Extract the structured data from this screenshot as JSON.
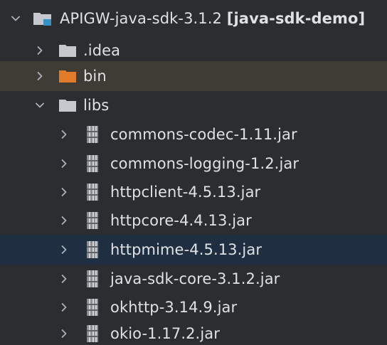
{
  "tree": {
    "root": {
      "name": "APIGW-java-sdk-3.1.2",
      "module": "[java-sdk-demo]",
      "expanded": true,
      "icon": "module-folder-icon"
    },
    "children": [
      {
        "name": ".idea",
        "type": "folder",
        "expanded": false,
        "icon": "folder-icon"
      },
      {
        "name": "bin",
        "type": "folder-excluded",
        "expanded": false,
        "icon": "excluded-folder-icon"
      },
      {
        "name": "libs",
        "type": "folder",
        "expanded": true,
        "icon": "folder-icon"
      }
    ],
    "libs": [
      {
        "name": "commons-codec-1.11.jar",
        "icon": "jar-icon"
      },
      {
        "name": "commons-logging-1.2.jar",
        "icon": "jar-icon"
      },
      {
        "name": "httpclient-4.5.13.jar",
        "icon": "jar-icon"
      },
      {
        "name": "httpcore-4.4.13.jar",
        "icon": "jar-icon"
      },
      {
        "name": "httpmime-4.5.13.jar",
        "icon": "jar-icon",
        "selected": true
      },
      {
        "name": "java-sdk-core-3.1.2.jar",
        "icon": "jar-icon"
      },
      {
        "name": "okhttp-3.14.9.jar",
        "icon": "jar-icon"
      },
      {
        "name": "okio-1.17.2.jar",
        "icon": "jar-icon"
      }
    ]
  },
  "colors": {
    "background": "#2b2d30",
    "text": "#dfe1e5",
    "folder": "#c5c8cf",
    "excluded_folder": "#e07b2a",
    "module_badge": "#3592c4",
    "selected_row": "#1f2e40",
    "highlight_row": "#3f3c35",
    "chevron": "#aeb3ba",
    "jar_stripe_dark": "#8c8f94",
    "jar_stripe_light": "#cfd2d6"
  }
}
